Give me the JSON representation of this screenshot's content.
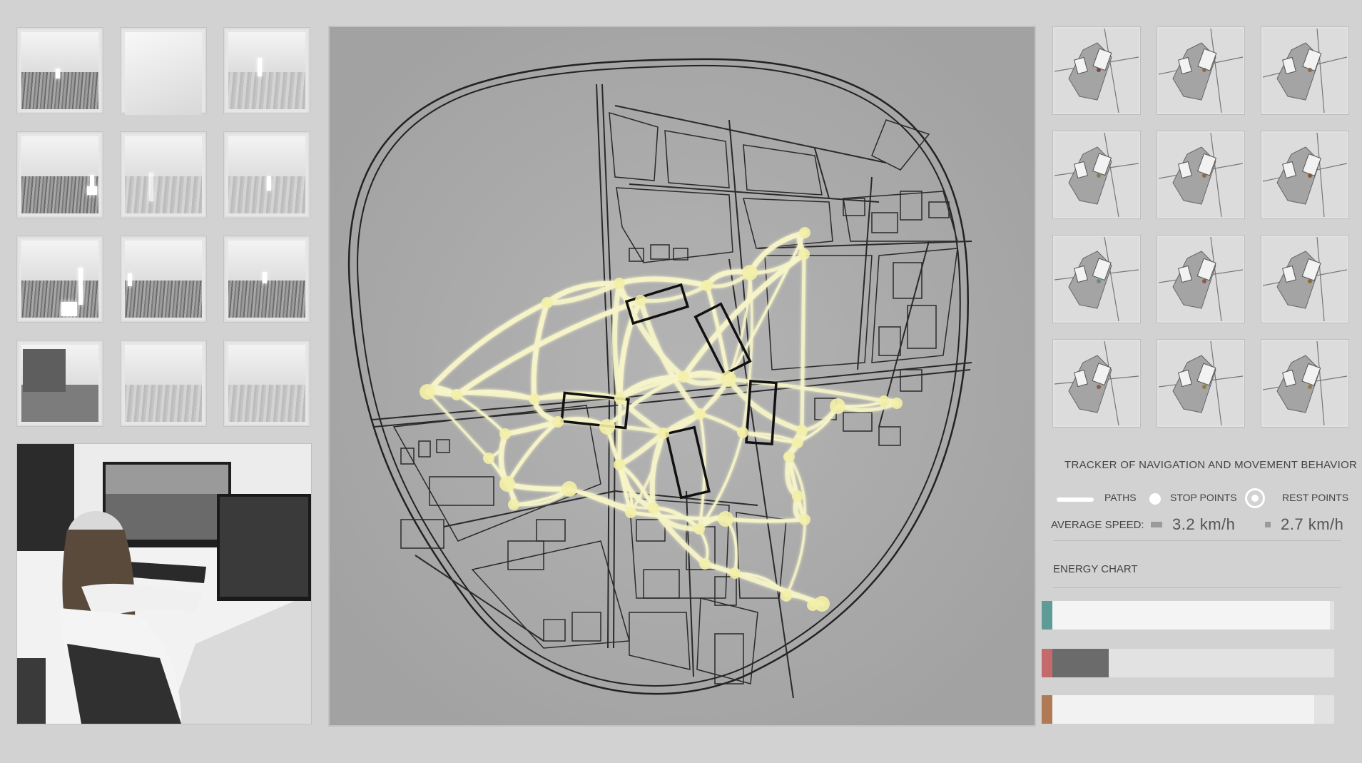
{
  "tracker": {
    "title": "TRACKER OF NAVIGATION AND MOVEMENT BEHAVIOR",
    "legend": {
      "paths": "PATHS",
      "stop_points": "STOP POINTS",
      "rest_points": "REST POINTS"
    },
    "average_speed_label": "AVERAGE SPEED:",
    "speeds": [
      "3.2 km/h",
      "2.7 km/h"
    ]
  },
  "energy": {
    "title": "ENERGY CHART",
    "bars": [
      {
        "color": "#5f9c98",
        "fill_color": "#f4f4f4",
        "fraction": 0.985
      },
      {
        "color": "#c46a6c",
        "fill_color": "#6b6b6b",
        "fraction": 0.2
      },
      {
        "color": "#b07a55",
        "fill_color": "#f2f2f2",
        "fraction": 0.93
      }
    ]
  },
  "colors": {
    "path": "#f6f3c8",
    "stop_point": "#f3f0a8",
    "background": "#d2d2d2",
    "map_background": "#ababab"
  },
  "icons": [
    "paths-line-icon",
    "stop-point-icon",
    "rest-point-icon"
  ]
}
